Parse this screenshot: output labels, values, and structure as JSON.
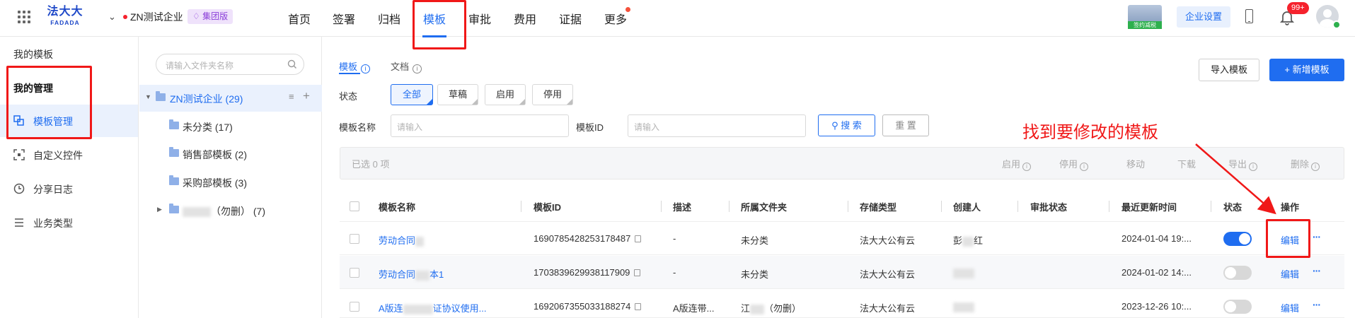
{
  "topbar": {
    "logo_cn": "法大大",
    "logo_en": "FADADA",
    "company": "ZN测试企业",
    "group_badge": "集团版",
    "nav": [
      "首页",
      "签署",
      "归档",
      "模板",
      "审批",
      "费用",
      "证据",
      "更多"
    ],
    "active_nav": "模板",
    "banner_text": "签约减税",
    "enterprise_settings": "企业设置",
    "notification_badge": "99+"
  },
  "sidebar": {
    "title": "我的模板",
    "group": "我的管理",
    "items": [
      {
        "label": "模板管理",
        "icon": "template-manage-icon",
        "active": true
      },
      {
        "label": "自定义控件",
        "icon": "custom-control-icon",
        "active": false
      },
      {
        "label": "分享日志",
        "icon": "share-log-icon",
        "active": false
      },
      {
        "label": "业务类型",
        "icon": "business-type-icon",
        "active": false
      }
    ]
  },
  "folders": {
    "search_placeholder": "请输入文件夹名称",
    "root": "ZN测试企业 (29)",
    "children": [
      {
        "label": "未分类 (17)"
      },
      {
        "label": "销售部模板 (2)"
      },
      {
        "label": "采购部模板 (3)"
      }
    ],
    "collapsed_suffix": "（勿删） (7)"
  },
  "main": {
    "tabs": [
      "模板",
      "文档"
    ],
    "status_label": "状态",
    "status_options": [
      "全部",
      "草稿",
      "启用",
      "停用"
    ],
    "name_label": "模板名称",
    "name_placeholder": "请输入",
    "id_label": "模板ID",
    "id_placeholder": "请输入",
    "search_btn": "搜 索",
    "reset_btn": "重 置",
    "import_btn": "导入模板",
    "new_btn": "+ 新增模板",
    "annotation": "找到要修改的模板",
    "bulk": {
      "selected": "已选 0 项",
      "actions": [
        "启用",
        "停用",
        "移动",
        "下载",
        "导出",
        "删除"
      ]
    },
    "columns": [
      "模板名称",
      "模板ID",
      "描述",
      "所属文件夹",
      "存储类型",
      "创建人",
      "审批状态",
      "最近更新时间",
      "状态",
      "操作"
    ],
    "rows": [
      {
        "name": "劳动合同",
        "id": "1690785428253178487",
        "desc": "-",
        "folder": "未分类",
        "storage": "法大大公有云",
        "creator": "彭",
        "creator_tail": "红",
        "updated": "2024-01-04 19:...",
        "enabled": true,
        "action": "编辑"
      },
      {
        "name": "劳动合同",
        "name_tail": "本1",
        "id": "1703839629938117909",
        "desc": "-",
        "folder": "未分类",
        "storage": "法大大公有云",
        "creator": "",
        "creator_tail": "",
        "updated": "2024-01-02 14:...",
        "enabled": false,
        "action": "编辑"
      },
      {
        "name": "A版连",
        "name_tail": "证协议使用...",
        "id": "1692067355033188274",
        "desc": "A版连带...",
        "folder": "江",
        "folder_tail": "（勿删）",
        "storage": "法大大公有云",
        "creator": "",
        "creator_tail": "",
        "updated": "2023-12-26 10:...",
        "enabled": false,
        "action": "编辑"
      }
    ]
  },
  "colors": {
    "primary": "#1f6df0",
    "annotation": "#f01818",
    "badge": "#f5222d"
  }
}
